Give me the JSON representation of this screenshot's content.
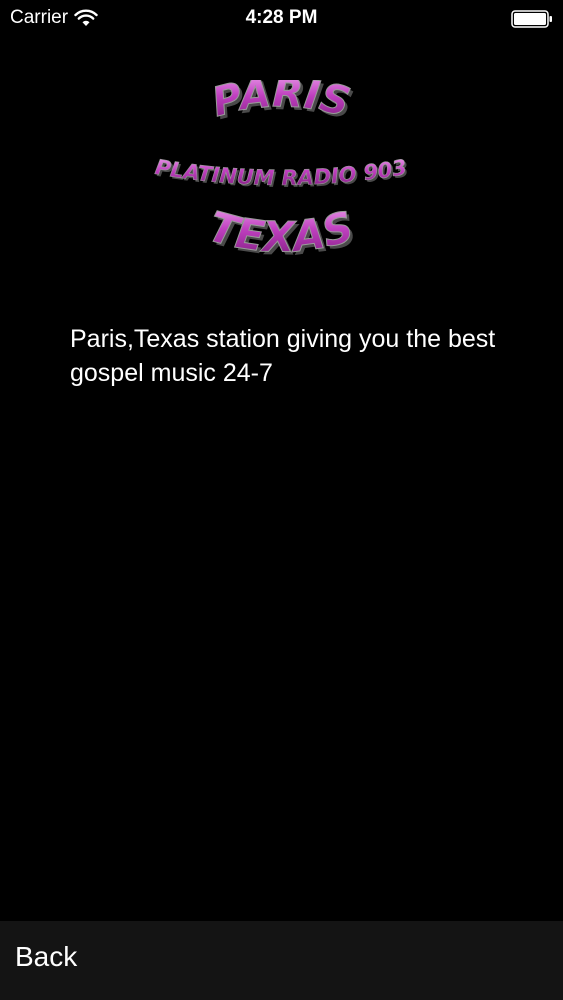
{
  "status_bar": {
    "carrier": "Carrier",
    "time": "4:28 PM",
    "wifi_icon": "wifi-icon",
    "battery_icon": "battery-full-icon"
  },
  "logo": {
    "line1": "PARIS",
    "line2": "PLATINUM RADIO 903",
    "line3": "TEXAS",
    "colors": {
      "primary": "#c040c0",
      "highlight": "#f0a8f0",
      "shadow": "#4a4a4a"
    }
  },
  "description": "Paris,Texas station giving you the best gospel music 24-7",
  "bottom_bar": {
    "back_label": "Back"
  },
  "colors": {
    "background": "#000000",
    "bottom_bar": "#141414",
    "text": "#ffffff"
  }
}
